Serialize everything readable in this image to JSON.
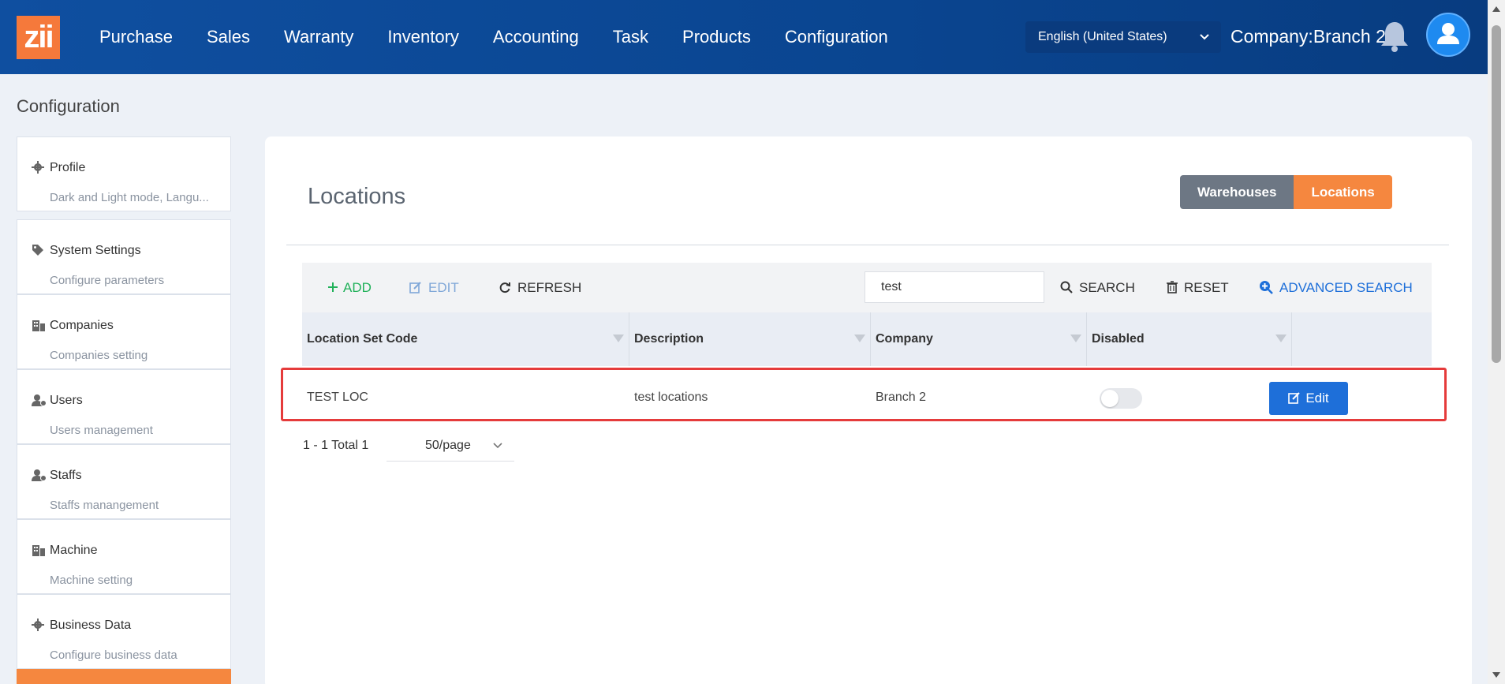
{
  "topbar": {
    "logo": "zii",
    "nav": [
      "Purchase",
      "Sales",
      "Warranty",
      "Inventory",
      "Accounting",
      "Task",
      "Products",
      "Configuration"
    ],
    "language": "English (United States)",
    "company": "Company:Branch 2"
  },
  "page_title": "Configuration",
  "sidebar": [
    {
      "title": "Profile",
      "subtitle": "Dark and Light mode, Langu...",
      "icon": "gear-icon"
    },
    {
      "title": "System Settings",
      "subtitle": "Configure parameters",
      "icon": "tags-icon"
    },
    {
      "title": "Companies",
      "subtitle": "Companies setting",
      "icon": "building-icon"
    },
    {
      "title": "Users",
      "subtitle": "Users management",
      "icon": "user-gear-icon"
    },
    {
      "title": "Staffs",
      "subtitle": "Staffs manangement",
      "icon": "user-gear-icon"
    },
    {
      "title": "Machine",
      "subtitle": "Machine setting",
      "icon": "building-icon"
    },
    {
      "title": "Business Data",
      "subtitle": "Configure business data",
      "icon": "gear-icon"
    }
  ],
  "main": {
    "title": "Locations",
    "segments": {
      "warehouses": "Warehouses",
      "locations": "Locations"
    },
    "toolbar": {
      "add": "ADD",
      "edit": "EDIT",
      "refresh": "REFRESH",
      "search_value": "test",
      "search": "SEARCH",
      "reset": "RESET",
      "advanced_search": "ADVANCED SEARCH"
    },
    "columns": [
      "Location Set Code",
      "Description",
      "Company",
      "Disabled"
    ],
    "rows": [
      {
        "code": "TEST LOC",
        "description": "test locations",
        "company": "Branch 2",
        "disabled": false,
        "action": "Edit"
      }
    ],
    "pager": {
      "summary": "1 - 1 Total 1",
      "page_size": "50/page"
    }
  },
  "colors": {
    "accent_orange": "#f5873f",
    "primary_blue": "#1e6fd9",
    "topbar": "#0f4fa0"
  }
}
